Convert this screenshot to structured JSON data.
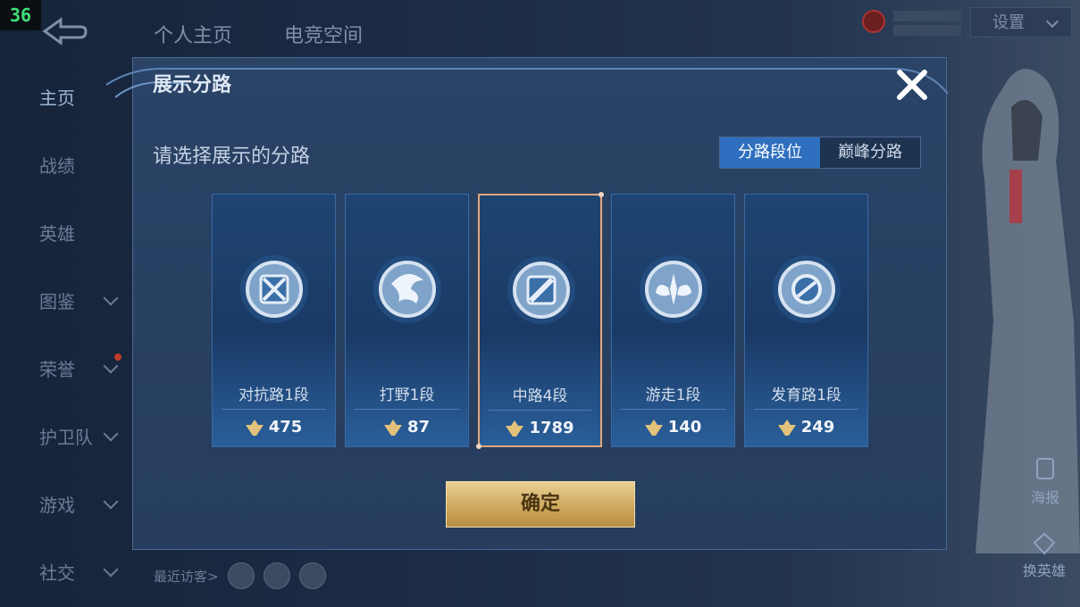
{
  "overlay": {
    "fps": "36"
  },
  "top_tabs": [
    "个人主页",
    "电竞空间"
  ],
  "sidebar": {
    "items": [
      {
        "label": "主页",
        "active": true
      },
      {
        "label": "战绩"
      },
      {
        "label": "英雄"
      },
      {
        "label": "图鉴",
        "chevron": true
      },
      {
        "label": "荣誉",
        "chevron": true,
        "dot": true
      },
      {
        "label": "护卫队",
        "chevron": true
      },
      {
        "label": "游戏",
        "chevron": true
      },
      {
        "label": "社交",
        "chevron": true
      }
    ]
  },
  "recent_visitors": {
    "label": "最近访客>"
  },
  "settings": {
    "label": "设置"
  },
  "right_buttons": {
    "poster": "海报",
    "switch_hero": "换英雄"
  },
  "dialog": {
    "title": "展示分路",
    "prompt": "请选择展示的分路",
    "segment": {
      "active": "分路段位",
      "inactive": "巅峰分路"
    },
    "confirm_label": "确定",
    "lanes": [
      {
        "name": "对抗路1段",
        "score": "475",
        "icon": "clash-lane-icon",
        "selected": false
      },
      {
        "name": "打野1段",
        "score": "87",
        "icon": "jungle-icon",
        "selected": false
      },
      {
        "name": "中路4段",
        "score": "1789",
        "icon": "mid-lane-icon",
        "selected": true
      },
      {
        "name": "游走1段",
        "score": "140",
        "icon": "roam-icon",
        "selected": false
      },
      {
        "name": "发育路1段",
        "score": "249",
        "icon": "farm-lane-icon",
        "selected": false
      }
    ]
  },
  "colors": {
    "accent": "#2f6fbf",
    "confirm_gold": "#cfa95e",
    "selected_border": "#e2a77a"
  }
}
